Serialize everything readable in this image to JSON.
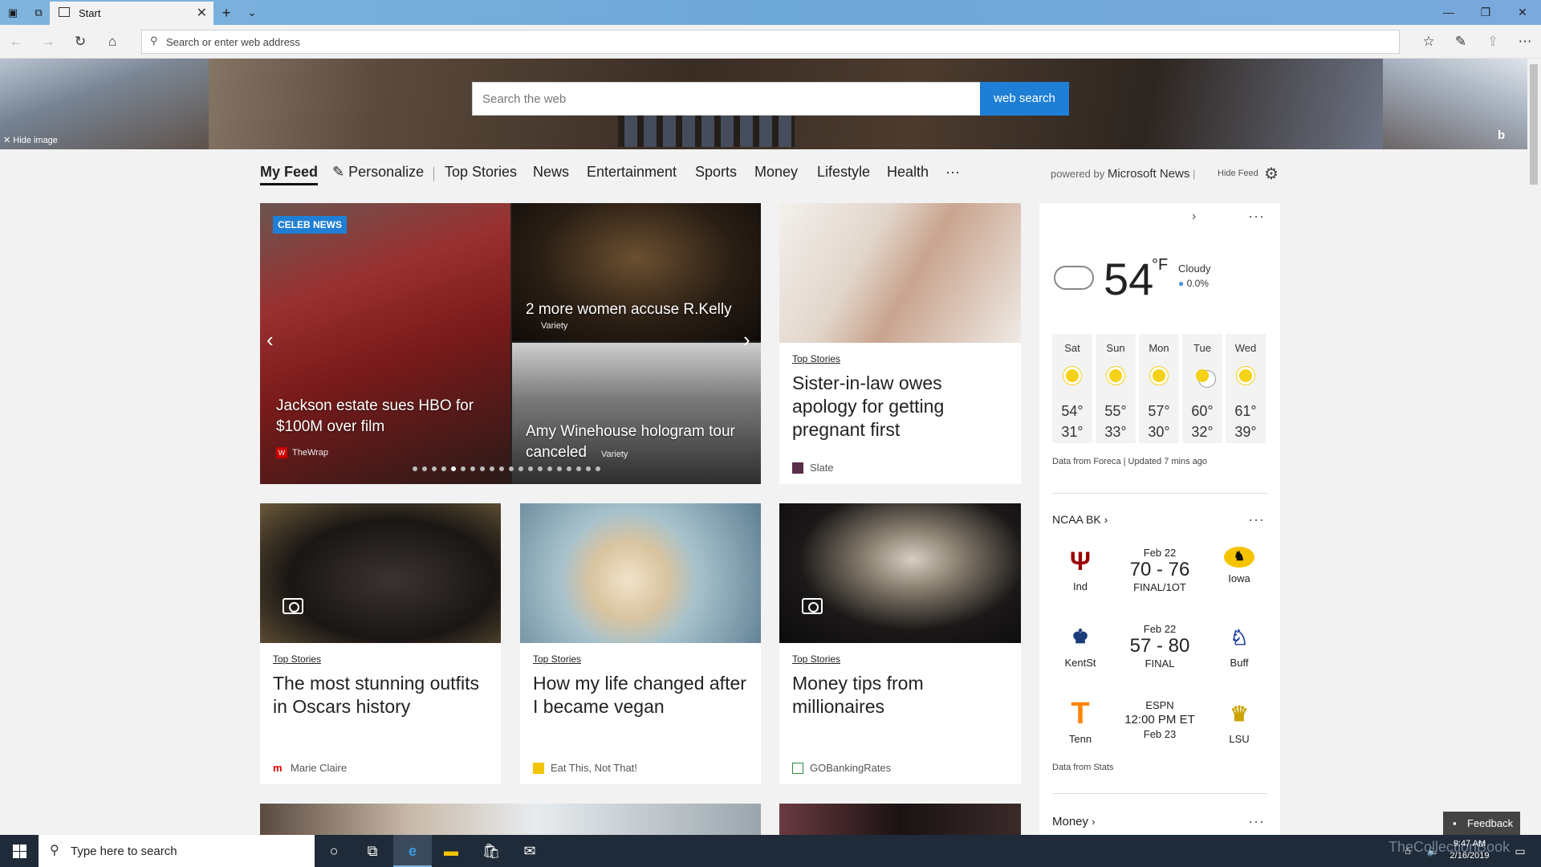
{
  "browser": {
    "tab_title": "Start",
    "address_placeholder": "Search or enter web address"
  },
  "hero": {
    "search_placeholder": "Search the web",
    "search_button": "web search",
    "hide_image": "Hide image"
  },
  "feed_nav": {
    "items": [
      "My Feed",
      "Personalize",
      "Top Stories",
      "News",
      "Entertainment",
      "Sports",
      "Money",
      "Lifestyle",
      "Health",
      "···"
    ],
    "powered_by_prefix": "powered by",
    "powered_by_name": "Microsoft News",
    "hide_feed": "Hide Feed"
  },
  "carousel": {
    "badge": "CELEB NEWS",
    "main": {
      "headline": "Jackson estate sues HBO for $100M over film",
      "source": "TheWrap"
    },
    "top_right": {
      "headline": "2 more women accuse R.Kelly",
      "source": "Variety"
    },
    "bottom_right": {
      "headline": "Amy Winehouse hologram tour canceled",
      "source": "Variety"
    },
    "active_dot": 4,
    "dot_count": 20
  },
  "cards": [
    {
      "category": "Top Stories",
      "headline": "Sister-in-law owes apology for getting pregnant first",
      "source": "Slate"
    },
    {
      "category": "Top Stories",
      "headline": "The most stunning outfits in Oscars history",
      "source": "Marie Claire"
    },
    {
      "category": "Top Stories",
      "headline": "How my life changed after I became vegan",
      "source": "Eat This, Not That!"
    },
    {
      "category": "Top Stories",
      "headline": "Money tips from millionaires",
      "source": "GOBankingRates"
    }
  ],
  "weather": {
    "temp": "54",
    "unit": "°F",
    "condition": "Cloudy",
    "precip": "0.0%",
    "forecast": [
      {
        "day": "Sat",
        "hi": "54°",
        "lo": "31°",
        "icon": "sun-icon"
      },
      {
        "day": "Sun",
        "hi": "55°",
        "lo": "33°",
        "icon": "sun-icon"
      },
      {
        "day": "Mon",
        "hi": "57°",
        "lo": "30°",
        "icon": "sun-icon"
      },
      {
        "day": "Tue",
        "hi": "60°",
        "lo": "32°",
        "icon": "partly-cloudy-icon"
      },
      {
        "day": "Wed",
        "hi": "61°",
        "lo": "39°",
        "icon": "sun-icon"
      }
    ],
    "data_source": "Data from Foreca | Updated 7 mins ago"
  },
  "ncaa": {
    "title": "NCAA BK",
    "games": [
      {
        "home": "Ind",
        "away": "Iowa",
        "date": "Feb 22",
        "score": "70 - 76",
        "status": "FINAL/1OT"
      },
      {
        "home": "KentSt",
        "away": "Buff",
        "date": "Feb 22",
        "score": "57 - 80",
        "status": "FINAL"
      },
      {
        "home": "Tenn",
        "away": "LSU",
        "date": "ESPN",
        "score": "12:00 PM ET",
        "status": "Feb 23"
      }
    ],
    "data_source": "Data from Stats"
  },
  "money": {
    "title": "Money"
  },
  "feedback": "Feedback",
  "taskbar": {
    "search_placeholder": "Type here to search",
    "time": "9:47 AM",
    "date": "2/16/2019",
    "watermark": "TheCollectionBook"
  },
  "colors": {
    "accent": "#1f7fd4",
    "taskbar": "#1f2b38"
  }
}
